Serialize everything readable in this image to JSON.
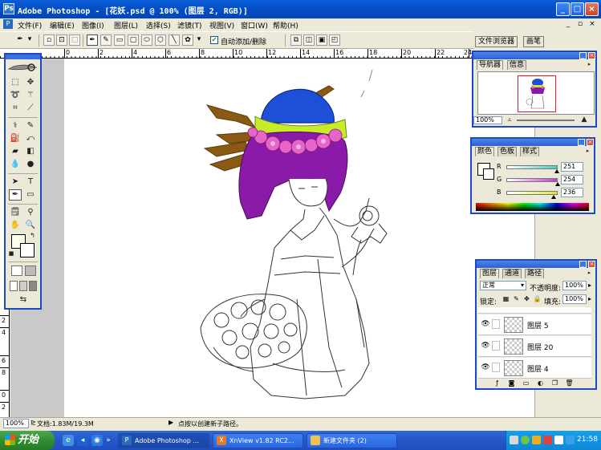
{
  "window": {
    "title": "Adobe Photoshop - [花妖.psd @ 100% (图层 2, RGB)]",
    "app_icon": "photoshop-icon",
    "controls": {
      "minimize": "_",
      "maximize": "□",
      "close": "×"
    }
  },
  "menu": {
    "items": [
      "文件(F)",
      "编辑(E)",
      "图像(I)",
      "图层(L)",
      "选择(S)",
      "滤镜(T)",
      "视图(V)",
      "窗口(W)",
      "帮助(H)"
    ],
    "doc_controls": {
      "minimize": "_",
      "restore": "▫",
      "close": "×"
    }
  },
  "options_bar": {
    "auto_add_delete_label": "自动添加/删除",
    "auto_add_delete_checked": true
  },
  "palette_well": {
    "tabs": [
      "文件浏览器",
      "画笔"
    ]
  },
  "rulers": {
    "top": [
      "0",
      "2",
      "4",
      "6",
      "8",
      "10",
      "12",
      "14",
      "16",
      "18",
      "20",
      "22",
      "24"
    ],
    "left": [
      "2",
      "4",
      "6",
      "8",
      "0",
      "2"
    ]
  },
  "navigator_panel": {
    "tabs": [
      "导航器",
      "信息"
    ],
    "zoom": "100%"
  },
  "color_panel": {
    "tabs": [
      "颜色",
      "色板",
      "样式"
    ],
    "channels": [
      {
        "label": "R",
        "value": "251",
        "level": 0.98,
        "color": "#3fd3c0"
      },
      {
        "label": "G",
        "value": "254",
        "level": 0.996,
        "color": "#c23ad8"
      },
      {
        "label": "B",
        "value": "236",
        "level": 0.925,
        "color": "#e4e43a"
      }
    ],
    "foreground_color": "#fbfeec"
  },
  "layers_panel": {
    "tabs": [
      "图层",
      "通道",
      "路径"
    ],
    "blend_mode": "正常",
    "opacity_label": "不透明度:",
    "opacity": "100%",
    "lock_label": "锁定:",
    "fill_label": "填充:",
    "fill": "100%",
    "layers": [
      {
        "name": "图层 5"
      },
      {
        "name": "图层 20"
      },
      {
        "name": "图层 4"
      }
    ]
  },
  "status_bar": {
    "zoom": "100%",
    "doc_size": "文档:1.83M/19.3M",
    "hint": "点按以创建新子路径。"
  },
  "taskbar": {
    "start_label": "开始",
    "tasks": [
      {
        "label": "Adobe Photoshop ...",
        "active": true
      },
      {
        "label": "XnView v1.82 RC2...",
        "active": false
      },
      {
        "label": "新建文件夹 (2)",
        "active": false
      }
    ],
    "clock": "21:58"
  },
  "colors": {
    "title_bar": "#0450c8",
    "panel_border": "#1c49c4",
    "taskbar": "#2457c8",
    "start_button": "#2f8c2f",
    "hair": "#8a1aa8",
    "hat": "#1e4fd8",
    "hat_band": "#c9ec2a",
    "flowers": "#e765c9",
    "branches": "#8a5a14"
  }
}
